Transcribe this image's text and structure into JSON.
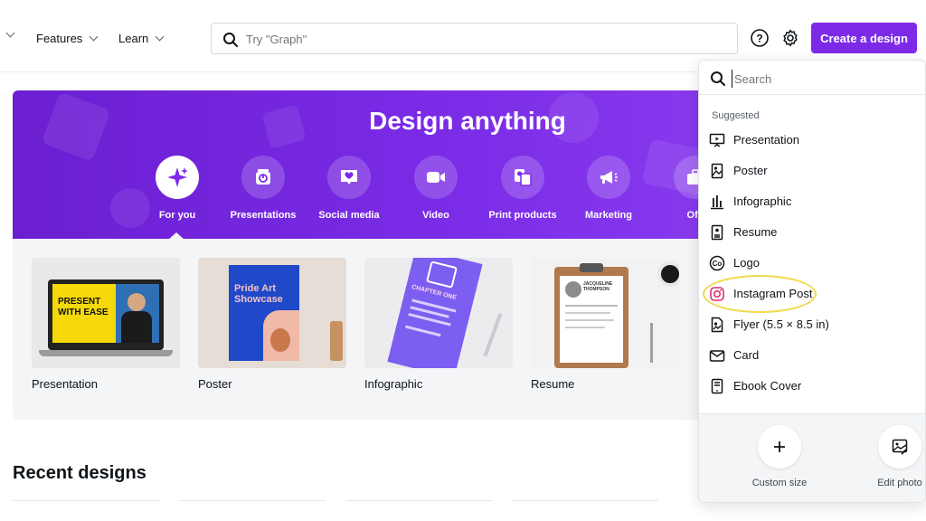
{
  "nav": {
    "features": "Features",
    "learn": "Learn"
  },
  "search": {
    "placeholder": "Try \"Graph\""
  },
  "header": {
    "create_label": "Create a design",
    "help_icon": "help-icon",
    "settings_icon": "gear-icon"
  },
  "hero": {
    "title": "Design anything",
    "categories": [
      {
        "label": "For you",
        "icon": "sparkle-icon",
        "active": true
      },
      {
        "label": "Presentations",
        "icon": "presentation-icon"
      },
      {
        "label": "Social media",
        "icon": "heart-icon"
      },
      {
        "label": "Video",
        "icon": "video-icon"
      },
      {
        "label": "Print products",
        "icon": "print-icon"
      },
      {
        "label": "Marketing",
        "icon": "megaphone-icon"
      },
      {
        "label": "Offi",
        "icon": "briefcase-icon"
      }
    ]
  },
  "gallery": {
    "cards": [
      {
        "caption": "Presentation",
        "thumb_text": "PRESENT\nWITH EASE"
      },
      {
        "caption": "Poster",
        "thumb_text": "Pride Art\nShowcase"
      },
      {
        "caption": "Infographic",
        "thumb_text": "CHAPTER ONE"
      },
      {
        "caption": "Resume",
        "thumb_text": "JACQUELINE\nTHOMPSON"
      }
    ]
  },
  "recent": {
    "title": "Recent designs"
  },
  "dropdown": {
    "search_placeholder": "Search",
    "section_label": "Suggested",
    "items": [
      {
        "label": "Presentation",
        "icon": "presentation-icon"
      },
      {
        "label": "Poster",
        "icon": "poster-icon"
      },
      {
        "label": "Infographic",
        "icon": "bar-chart-icon"
      },
      {
        "label": "Resume",
        "icon": "document-icon"
      },
      {
        "label": "Logo",
        "icon": "logo-co-icon"
      },
      {
        "label": "Instagram Post",
        "icon": "instagram-icon"
      },
      {
        "label": "Flyer (5.5 × 8.5 in)",
        "icon": "flyer-icon"
      },
      {
        "label": "Card",
        "icon": "envelope-icon"
      },
      {
        "label": "Ebook Cover",
        "icon": "ebook-icon"
      }
    ],
    "custom_size_label": "Custom size",
    "edit_photo_label": "Edit photo"
  },
  "colors": {
    "accent": "#7d2ae8",
    "hero": "#7a2be6",
    "highlight": "#f1d94a",
    "instagram": "#e1306c"
  }
}
